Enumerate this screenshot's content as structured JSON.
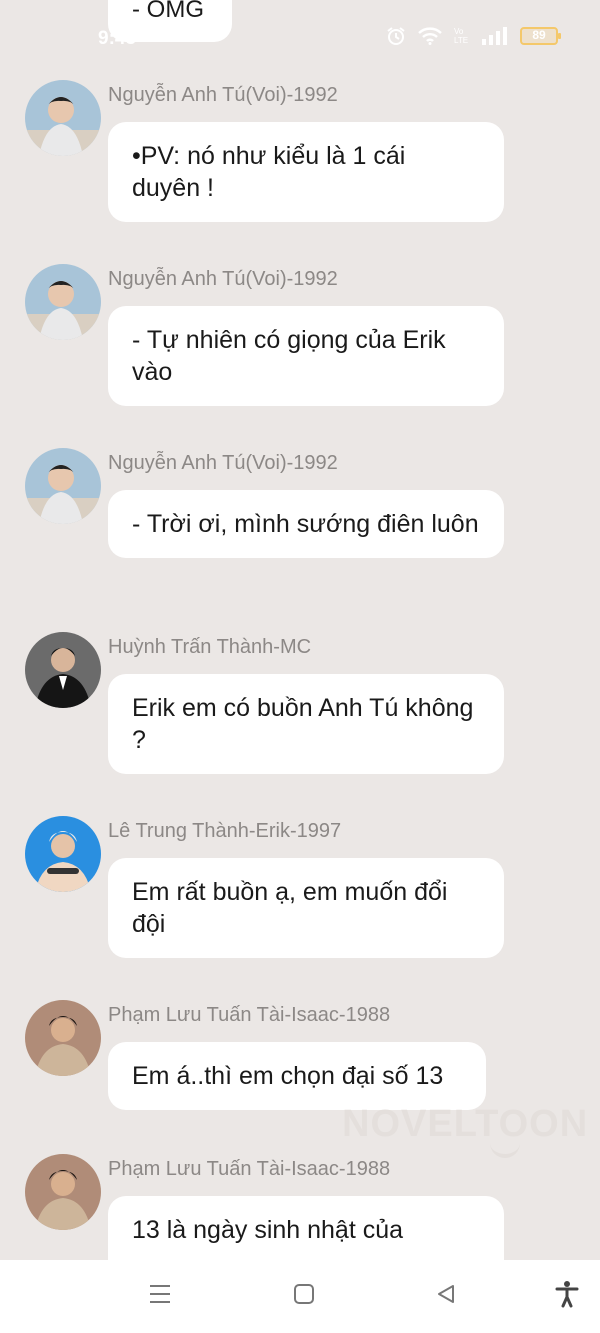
{
  "status_bar": {
    "time": "9:43",
    "battery": "89",
    "icons": [
      "alarm-icon",
      "wifi-icon",
      "volte-icon",
      "signal-icon",
      "battery-icon"
    ]
  },
  "top_message": {
    "text": "- OMG"
  },
  "messages": [
    {
      "sender": "Nguyễn Anh Tú(Voi)-1992",
      "text": "•PV: nó như kiểu là 1 cái duyên !",
      "avatar": "voi"
    },
    {
      "sender": "Nguyễn Anh Tú(Voi)-1992",
      "text": "- Tự nhiên có giọng của Erik vào",
      "avatar": "voi"
    },
    {
      "sender": "Nguyễn Anh Tú(Voi)-1992",
      "text": "- Trời ơi, mình sướng điên luôn",
      "avatar": "voi"
    },
    {
      "sender": "Huỳnh Trấn Thành-MC",
      "text": "Erik em có buồn Anh Tú không ?",
      "avatar": "mc"
    },
    {
      "sender": "Lê Trung Thành-Erik-1997",
      "text": "Em rất buồn ạ, em muốn đổi đội",
      "avatar": "erik"
    },
    {
      "sender": "Phạm Lưu Tuấn Tài-Isaac-1988",
      "text": "Em á..thì em chọn đại số 13",
      "avatar": "isaac"
    },
    {
      "sender": "Phạm Lưu Tuấn Tài-Isaac-1988",
      "text": "13 là ngày sinh nhật của",
      "avatar": "isaac"
    }
  ],
  "watermark": "NOVELTOON",
  "nav_bar": {
    "icons": [
      "menu-icon",
      "home-square-icon",
      "back-triangle-icon",
      "accessibility-icon"
    ]
  },
  "colors": {
    "background": "#ebe7e5",
    "bubble": "#ffffff",
    "sender": "#8c8886",
    "text": "#1a1a1a",
    "battery": "#f4c86a"
  }
}
